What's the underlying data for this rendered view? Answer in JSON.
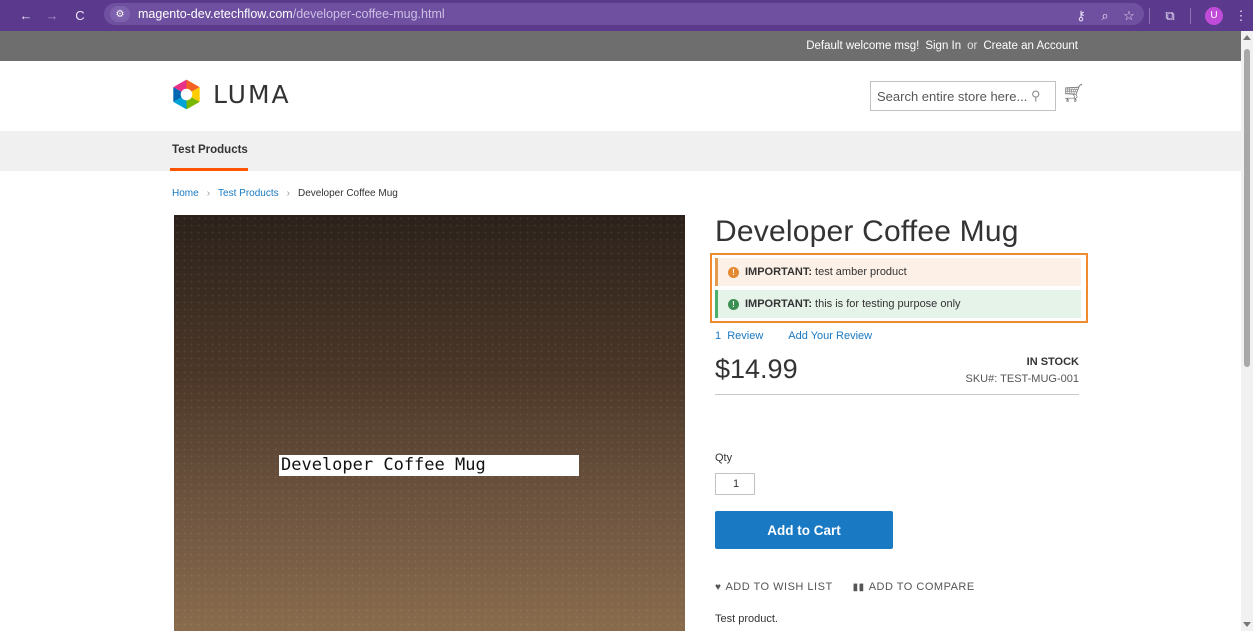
{
  "browser": {
    "url_host": "magento-dev.etechflow.com",
    "url_path": "/developer-coffee-mug.html",
    "profile_initial": "U",
    "icons": [
      "back-icon",
      "forward-icon",
      "reload-icon",
      "site-settings-icon",
      "password-key-icon",
      "zoom-icon",
      "bookmark-star-icon",
      "extensions-icon",
      "menu-icon"
    ]
  },
  "panel_header": {
    "welcome": "Default welcome msg!",
    "sign_in": "Sign In",
    "or": "or",
    "create_account": "Create an Account"
  },
  "header": {
    "logo_text": "LUMA",
    "search_placeholder": "Search entire store here..."
  },
  "nav": {
    "items": [
      {
        "label": "Test Products"
      }
    ]
  },
  "breadcrumbs": {
    "home": "Home",
    "category": "Test Products",
    "current": "Developer Coffee Mug",
    "separator": "›"
  },
  "gallery": {
    "caption": "Developer Coffee Mug"
  },
  "product": {
    "title": "Developer Coffee Mug",
    "notices": [
      {
        "label": "IMPORTANT:",
        "text": "test amber product",
        "color": "#e38a30"
      },
      {
        "label": "IMPORTANT:",
        "text": "this is for testing purpose only",
        "color": "#3c8f52"
      }
    ],
    "reviews_count": "1  Review",
    "add_review": "Add Your Review",
    "price": "$14.99",
    "stock": "IN STOCK",
    "sku_label": "SKU#:",
    "sku_value": "TEST-MUG-001",
    "qty_label": "Qty",
    "qty_value": "1",
    "add_to_cart": "Add to Cart",
    "wishlist": "ADD TO WISH LIST",
    "compare": "ADD TO COMPARE",
    "description": "Test product."
  },
  "colors": {
    "accent_blue": "#1979c3",
    "nav_underline": "#ff5501",
    "highlight_border": "#ef8a2e"
  }
}
